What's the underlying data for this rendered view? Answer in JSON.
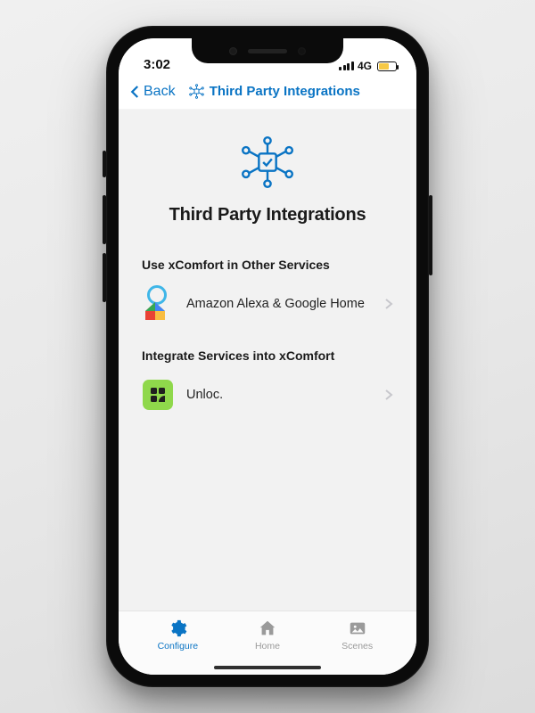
{
  "status": {
    "time": "3:02",
    "carrier": "4G"
  },
  "nav": {
    "back": "Back",
    "title": "Third Party Integrations"
  },
  "page": {
    "heading": "Third Party Integrations",
    "section1": {
      "title": "Use xComfort in Other Services",
      "item1": "Amazon Alexa & Google Home"
    },
    "section2": {
      "title": "Integrate Services into xComfort",
      "item1": "Unloc."
    }
  },
  "tabs": {
    "configure": "Configure",
    "home": "Home",
    "scenes": "Scenes"
  }
}
